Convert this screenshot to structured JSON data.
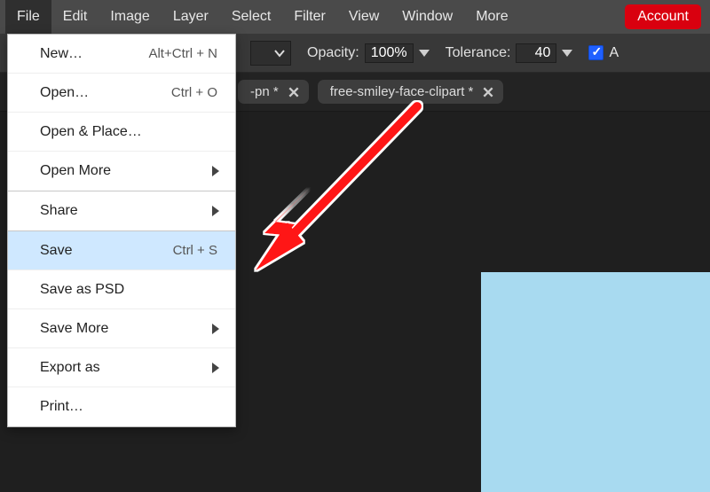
{
  "menubar": {
    "items": [
      "File",
      "Edit",
      "Image",
      "Layer",
      "Select",
      "Filter",
      "View",
      "Window",
      "More"
    ],
    "account": "Account",
    "active_index": 0
  },
  "options": {
    "opacity_label": "Opacity:",
    "opacity_value": "100%",
    "tolerance_label": "Tolerance:",
    "tolerance_value": "40",
    "checkbox_checked": true,
    "trailing_text": "A"
  },
  "tabs": [
    {
      "label": "-pn *",
      "partial": true
    },
    {
      "label": "free-smiley-face-clipart *",
      "partial": true
    }
  ],
  "file_menu": {
    "items": [
      {
        "label": "New…",
        "shortcut": "Alt+Ctrl + N",
        "submenu": false
      },
      {
        "label": "Open…",
        "shortcut": "Ctrl + O",
        "submenu": false
      },
      {
        "label": "Open & Place…",
        "shortcut": "",
        "submenu": false
      },
      {
        "label": "Open More",
        "shortcut": "",
        "submenu": true
      },
      {
        "_sep": true
      },
      {
        "label": "Share",
        "shortcut": "",
        "submenu": true
      },
      {
        "_sep": true
      },
      {
        "label": "Save",
        "shortcut": "Ctrl + S",
        "submenu": false,
        "highlight": true
      },
      {
        "label": "Save as PSD",
        "shortcut": "",
        "submenu": false
      },
      {
        "label": "Save More",
        "shortcut": "",
        "submenu": true
      },
      {
        "label": "Export as",
        "shortcut": "",
        "submenu": true
      },
      {
        "label": "Print…",
        "shortcut": "",
        "submenu": false
      }
    ]
  },
  "colors": {
    "canvas_fill": "#a8daf0",
    "arrow": "#ff1414"
  }
}
